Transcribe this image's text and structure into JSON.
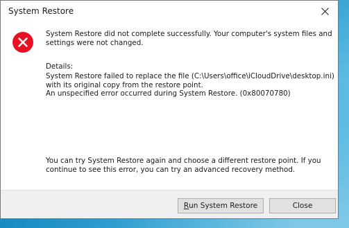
{
  "window": {
    "title": "System Restore"
  },
  "icons": {
    "close": "close-icon",
    "error": "error-icon"
  },
  "message": {
    "line1": "System Restore did not complete successfully. Your computer's system files and",
    "line2": "settings were not changed."
  },
  "details": {
    "label": "Details:",
    "line1": "System Restore failed to replace the file (C:\\Users\\office\\iCloudDrive\\desktop.ini)",
    "line2": "with its original copy from the restore point.",
    "line3": "An unspecified error occurred during System Restore. (0x80070780)"
  },
  "suggestion": {
    "line1": "You can try System Restore again and choose a different restore point. If you",
    "line2": "continue to see this error, you can try an advanced recovery method."
  },
  "buttons": {
    "run_accel": "R",
    "run_rest": "un System Restore",
    "close": "Close"
  },
  "colors": {
    "error_red": "#e81123",
    "dialog_bg": "#ffffff",
    "footer_bg": "#f0f0f0",
    "button_bg": "#e1e1e1"
  }
}
